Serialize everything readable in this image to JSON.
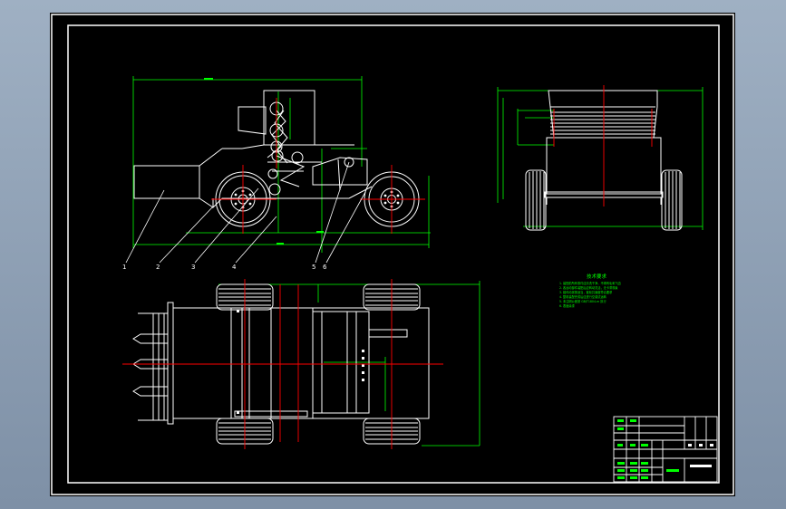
{
  "drawing": {
    "notes_title": "技术要求",
    "notes_lines": [
      "1. 装配前所有零件应清洗干净，不得有毛刺飞边",
      "2. 各运动部件装配后应转动灵活，无卡滞现象",
      "3. 链传动张紧适当，链轮共面度符合要求",
      "4. 整机装配完成后应进行空载试运转",
      "5. 未注明公差按 GB/T1804-m 执行",
      "6. 表面涂漆"
    ],
    "part_labels": [
      "1",
      "2",
      "3",
      "4",
      "5",
      "6"
    ],
    "colors": {
      "background": "#000000",
      "frame": "#ffffff",
      "dimension": "#00ff00",
      "centerline": "#ff0000",
      "geometry": "#ffffff"
    }
  }
}
